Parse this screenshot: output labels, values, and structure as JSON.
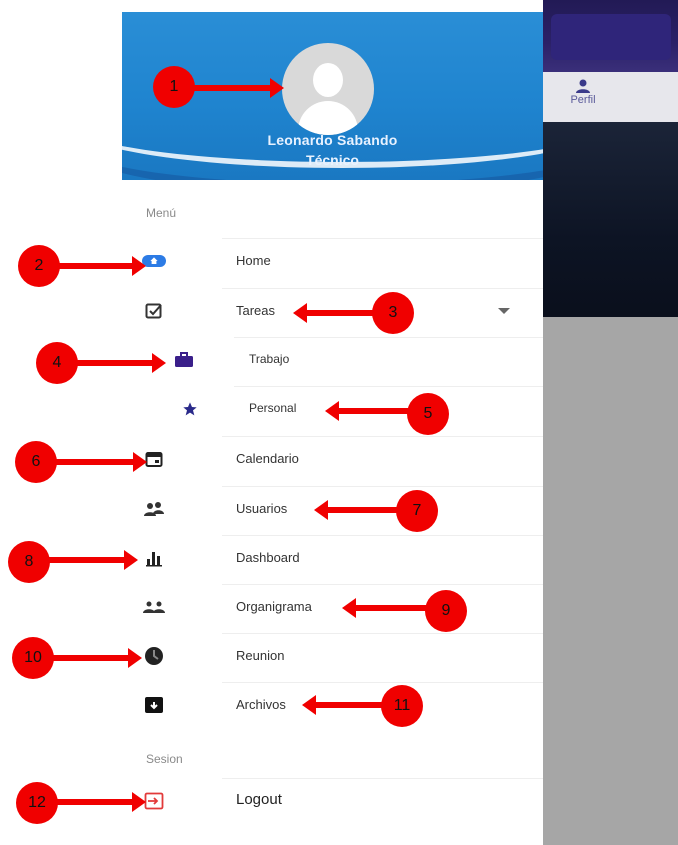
{
  "app": {
    "tab_profile_label": "Perfil"
  },
  "drawer": {
    "user_name": "Leonardo Sabando",
    "user_role": "Técnico",
    "section_menu": "Menú",
    "items": [
      {
        "label": "Home",
        "icon": "home-icon"
      },
      {
        "label": "Tareas",
        "icon": "tasks-check-icon"
      },
      {
        "label": "Trabajo",
        "icon": "briefcase-icon"
      },
      {
        "label": "Personal",
        "icon": "star-icon"
      },
      {
        "label": "Calendario",
        "icon": "calendar-icon"
      },
      {
        "label": "Usuarios",
        "icon": "users-icon"
      },
      {
        "label": "Dashboard",
        "icon": "bar-chart-icon"
      },
      {
        "label": "Organigrama",
        "icon": "group-icon"
      },
      {
        "label": "Reunion",
        "icon": "clock-icon"
      },
      {
        "label": "Archivos",
        "icon": "archive-icon"
      }
    ],
    "section_session": "Sesion",
    "logout_label": "Logout"
  },
  "annotations": [
    "1",
    "2",
    "3",
    "4",
    "5",
    "6",
    "7",
    "8",
    "9",
    "10",
    "11",
    "12"
  ],
  "colors": {
    "header_blue": "#1f84cf",
    "accent_purple": "#2b2168",
    "annotation_red": "#f00000"
  }
}
